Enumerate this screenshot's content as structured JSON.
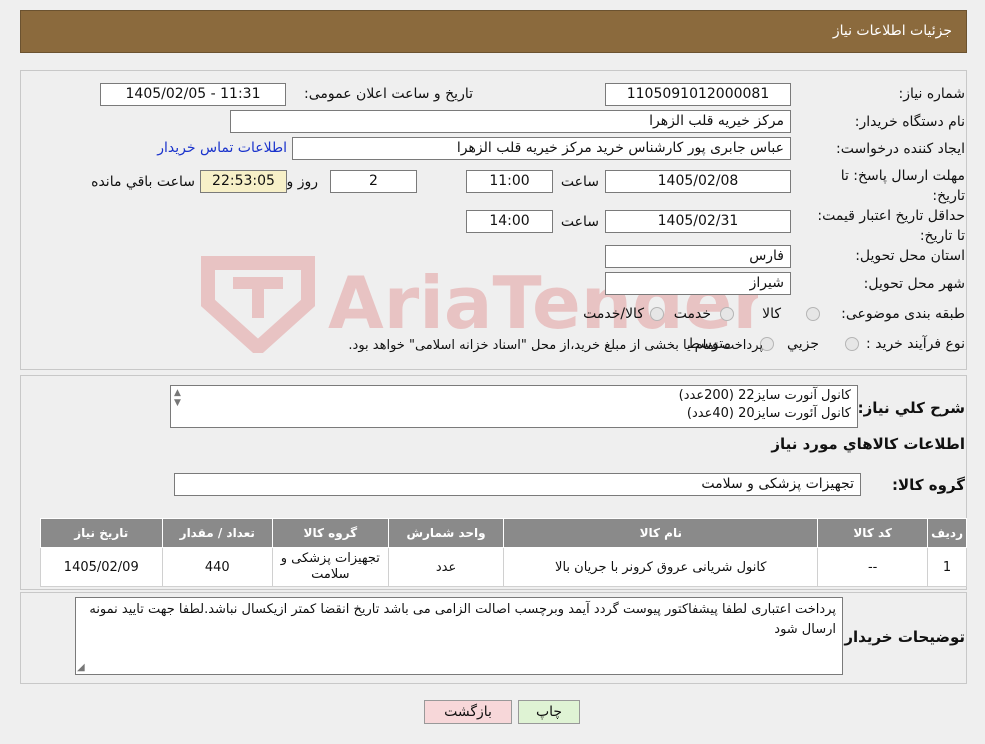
{
  "header": {
    "title": "جزئیات اطلاعات نیاز"
  },
  "form": {
    "need_number_label": "شماره نیاز:",
    "need_number": "1105091012000081",
    "announce_label": "تاریخ و ساعت اعلان عمومی:",
    "announce_value": "1405/02/05 - 11:31",
    "buyer_label": "نام دستگاه خریدار:",
    "buyer_value": "مرکز خیریه قلب الزهرا",
    "creator_label": "ایجاد کننده درخواست:",
    "creator_value": "عباس جابری پور کارشناس خرید مرکز خیریه قلب الزهرا",
    "contact_link": "اطلاعات تماس خریدار",
    "deadline_label": "مهلت ارسال پاسخ: تا تاریخ:",
    "deadline_date": "1405/02/08",
    "time_label": "ساعت",
    "deadline_time": "11:00",
    "days_value": "2",
    "days_label": "روز و",
    "remaining_time": "22:53:05",
    "remaining_label": "ساعت باقي مانده",
    "validity_label": "حداقل تاریخ اعتبار قیمت: تا تاریخ:",
    "validity_date": "1405/02/31",
    "validity_time": "14:00",
    "province_label": "استان محل تحویل:",
    "province_value": "فارس",
    "city_label": "شهر محل تحویل:",
    "city_value": "شیراز",
    "category_label": "طبقه بندی موضوعی:",
    "category_options": [
      "کالا",
      "خدمت",
      "کالا/خدمت"
    ],
    "process_label": "نوع فرآیند خرید :",
    "process_options": [
      "جزيي",
      "متوسط"
    ],
    "process_note": "پرداخت تمام یا بخشی از مبلغ خرید،از محل \"اسناد خزانه اسلامی\" خواهد بود."
  },
  "summary": {
    "label": "شرح کلي نياز:",
    "lines": [
      "کانول آنورت سایز22 (200عدد)",
      "کانول آئورت سایز20 (40عدد)"
    ],
    "goods_info_title": "اطلاعات کالاهاي مورد نياز",
    "group_label": "گروه کالا:",
    "group_value": "تجهیزات پزشکی و سلامت"
  },
  "table": {
    "headers": [
      "رديف",
      "کد کالا",
      "نام کالا",
      "واحد شمارش",
      "گروه کالا",
      "تعداد / مقدار",
      "تاريخ نياز"
    ],
    "rows": [
      [
        "1",
        "--",
        "کانول شریانی عروق کرونر با جریان بالا",
        "عدد",
        "تجهیزات پزشکی و سلامت",
        "440",
        "1405/02/09"
      ]
    ]
  },
  "buyer_notes": {
    "label": "توضیحات خریدار:",
    "text": "پرداخت اعتباری لطفا پیشفاکتور پیوست گردد آیمد وبرچسب اصالت الزامی می باشد تاریخ انقضا کمتر ازیکسال نباشد.لطفا جهت تایید نمونه ارسال شود"
  },
  "buttons": {
    "print": "چاپ",
    "back": "بازگشت"
  },
  "watermark": {
    "text": "AriaTender.neT"
  }
}
